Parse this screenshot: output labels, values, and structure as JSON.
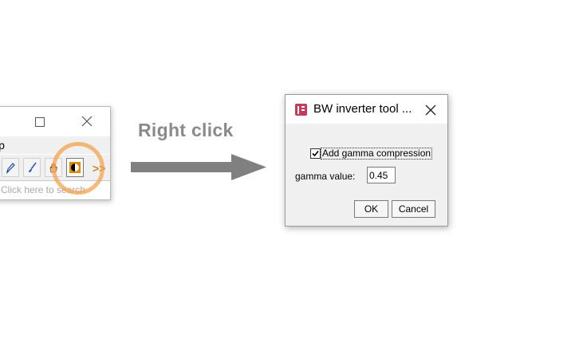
{
  "toolbar_window": {
    "menu_partial": "lp",
    "more_tools": ">>",
    "status_text": "Click here to search",
    "tools": [
      {
        "icon": "pencil-icon"
      },
      {
        "icon": "brush-icon"
      },
      {
        "icon": "hand-icon"
      },
      {
        "icon": "bw-inverter-icon",
        "selected": true
      }
    ]
  },
  "annotation": {
    "label": "Right click",
    "highlight_color": "#f3a34f",
    "arrow_color": "#808080"
  },
  "dialog": {
    "title": "BW inverter tool ...",
    "checkbox_label": "Add gamma compression",
    "checkbox_checked": true,
    "gamma_label": "gamma value:",
    "gamma_value": "0.45",
    "ok_label": "OK",
    "cancel_label": "Cancel",
    "icon_color": "#c33a5a"
  }
}
